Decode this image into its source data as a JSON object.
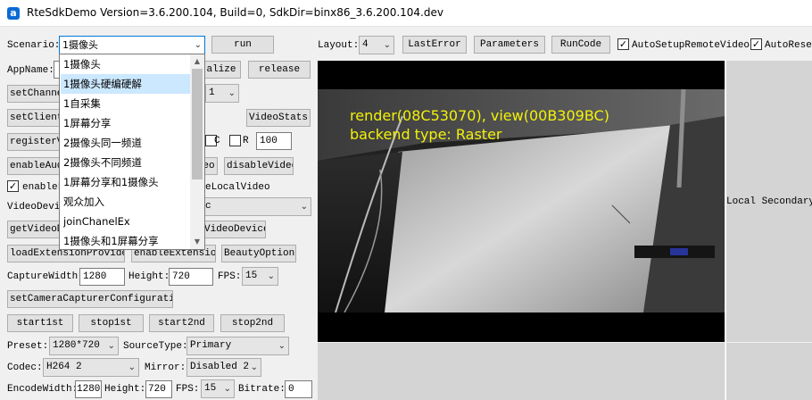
{
  "title": "RteSdkDemo Version=3.6.200.104, Build=0, SdkDir=binx86_3.6.200.104.dev",
  "top": {
    "scenario_label": "Scenario:",
    "scenario_value": "1摄像头",
    "run": "run",
    "layout_label": "Layout:",
    "layout_value": "4",
    "last_error": "LastError",
    "parameters": "Parameters",
    "run_code": "RunCode",
    "auto_setup_remote_video": "AutoSetupRemoteVideo",
    "auto_setup_remote_video_checked": true,
    "auto_reset": "AutoReset",
    "auto_reset_checked": true
  },
  "dropdown": {
    "items": [
      "1摄像头",
      "1摄像头硬编硬解",
      "1自采集",
      "1屏幕分享",
      "2摄像头同一频道",
      "2摄像头不同频道",
      "1屏幕分享和1摄像头",
      "观众加入",
      "joinChanelEx",
      "1摄像头和1屏幕分享"
    ],
    "selected_index": 1
  },
  "controls": {
    "appname_label": "AppName:",
    "initialize_btn": "alize",
    "release_btn": "release",
    "set_channel_btn": "setChanne",
    "channel_select_value": "1",
    "set_client_btn": "setClient",
    "video_stats_btn": "VideoStats",
    "register_btn": "registerV",
    "c_label": "C",
    "r_label": "R",
    "r_value": "100",
    "enable_audio_btn": "enableAud",
    "eo_btn": "eo",
    "disable_video_btn": "disableVideo",
    "enable_local_label": "enableL",
    "enable_local_checked": true,
    "local_video_label": "eLocalVideo",
    "video_device_label": "VideoDevic",
    "video_device_value": "c",
    "get_video_btn": "getVideoD",
    "video_device_btn": "VideoDevice",
    "load_extension_btn": "loadExtensionProvider",
    "enable_extension_btn": "enableExtension",
    "beauty_options_btn": "BeautyOptions",
    "capture_width_label": "CaptureWidth:",
    "capture_width": "1280",
    "height_label": "Height:",
    "capture_height": "720",
    "fps_label": "FPS:",
    "fps_value": "15",
    "set_camera_btn": "setCameraCapturerConfiguration",
    "start1st": "start1st",
    "stop1st": "stop1st",
    "start2nd": "start2nd",
    "stop2nd": "stop2nd",
    "preset_label": "Preset:",
    "preset_value": "1280*720",
    "source_type_label": "SourceType:",
    "source_type_value": "Primary",
    "codec_label": "Codec:",
    "codec_value": "H264 2",
    "mirror_label": "Mirror:",
    "mirror_value": "Disabled 2",
    "encode_width_label": "EncodeWidth:",
    "encode_width": "1280",
    "encode_height_label": "Height:",
    "encode_height": "720",
    "encode_fps_label": "FPS:",
    "encode_fps": "15",
    "bitrate_label": "Bitrate:",
    "bitrate": "0"
  },
  "video": {
    "overlay_render": "render(08C53070), view(00B309BC)",
    "overlay_backend": "backend type: Raster",
    "local_secondary": "Local Secondary"
  },
  "colors": {
    "overlay_text": "#f2f20a",
    "selected_item": "#cce8ff",
    "app_icon": "#0a6ad6"
  }
}
